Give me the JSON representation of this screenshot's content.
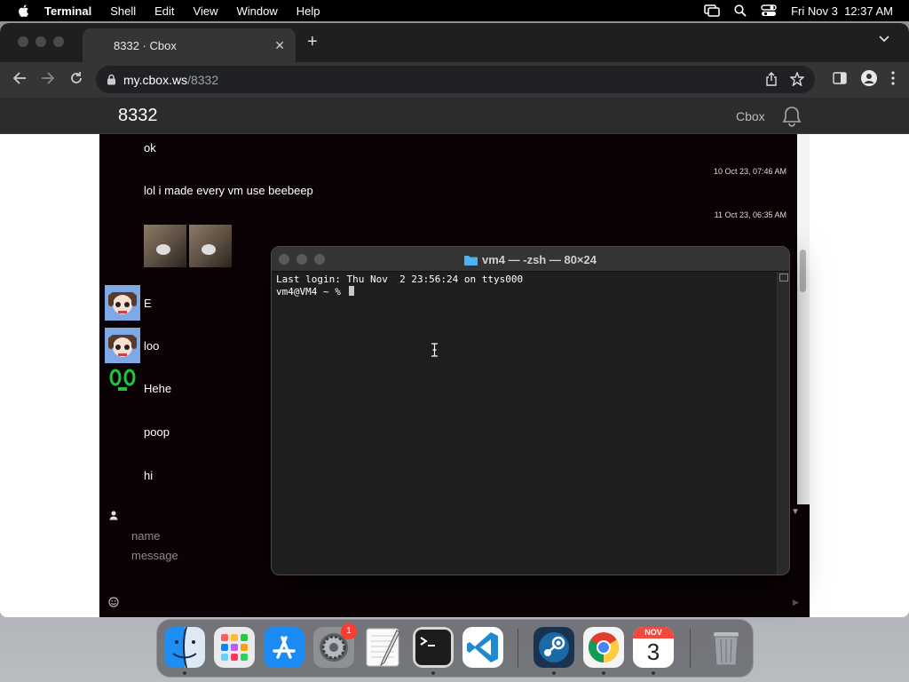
{
  "menubar": {
    "app": "Terminal",
    "items": [
      "Shell",
      "Edit",
      "View",
      "Window",
      "Help"
    ],
    "clock": "Fri Nov 3  12:37 AM"
  },
  "browser": {
    "tab_title": "8332 · Cbox",
    "url_host": "my.cbox.ws",
    "url_path": "/8332"
  },
  "site": {
    "title": "8332",
    "nav_link": "Cbox"
  },
  "chat": {
    "messages": [
      {
        "text": "ok"
      },
      {
        "time": "10 Oct 23, 07:46 AM",
        "text": "lol i made every vm use beebeep"
      },
      {
        "time": "11 Oct 23, 06:35 AM"
      },
      {
        "text": "E"
      },
      {
        "text": "loo"
      },
      {
        "text": "Hehe"
      },
      {
        "text": "poop"
      },
      {
        "text": "hi"
      }
    ],
    "name_placeholder": "name",
    "message_placeholder": "message"
  },
  "terminal": {
    "title": "vm4 — -zsh — 80×24",
    "lines": [
      "Last login: Thu Nov  2 23:56:24 on ttys000",
      "vm4@VM4 ~ % "
    ]
  },
  "dock": {
    "apps": [
      "finder-icon",
      "launchpad-icon",
      "app-store-icon",
      "system-settings-icon",
      "textedit-icon",
      "terminal-icon",
      "vscode-icon",
      "steam-icon",
      "chrome-icon",
      "calendar-icon",
      "trash-icon"
    ],
    "settings_badge": "1",
    "calendar_month": "NOV",
    "calendar_day": "3"
  }
}
